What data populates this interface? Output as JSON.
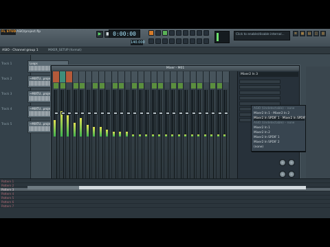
{
  "app": {
    "logo_text": "FL STUDIO",
    "menu_text": "ASIO/project.flp",
    "clock": "0:00:00",
    "tempo": "140.000",
    "hint": "Click to enable/disable internal...",
    "header_title": "ASIO - Channel group 1",
    "header_sub": "MIXER_SETUP (format)"
  },
  "browser": {
    "tracks": [
      "Track 1",
      "Track 2",
      "Track 3",
      "Track 4",
      "Track 5"
    ]
  },
  "clips": [
    {
      "name": "Loops"
    },
    {
      "name": "~MIXTU...project_5"
    },
    {
      "name": "~MIXTU...project_3"
    },
    {
      "name": "~MIXTU...project_4"
    },
    {
      "name": "~MIXTU...project_1"
    }
  ],
  "mixer": {
    "title": "Mixer - M01",
    "strips": [
      {
        "meter": 0.35,
        "fader": 0.75,
        "label": "hi"
      },
      {
        "meter": 0.55,
        "fader": 0.75,
        "label": "hi2"
      },
      {
        "meter": 0.45,
        "fader": 0.75,
        "label": "hi"
      },
      {
        "meter": 0.3,
        "fader": 0.75,
        "label": ""
      },
      {
        "meter": 0.4,
        "fader": 0.75,
        "label": ""
      },
      {
        "meter": 0.25,
        "fader": 0.75,
        "label": ""
      },
      {
        "meter": 0.2,
        "fader": 0.75,
        "label": ""
      },
      {
        "meter": 0.2,
        "fader": 0.75,
        "label": ""
      },
      {
        "meter": 0.15,
        "fader": 0.75,
        "label": ""
      },
      {
        "meter": 0.1,
        "fader": 0.75,
        "label": ""
      },
      {
        "meter": 0.1,
        "fader": 0.75,
        "label": ""
      },
      {
        "meter": 0.1,
        "fader": 0.75,
        "label": ""
      },
      {
        "meter": 0.05,
        "fader": 0.75,
        "label": ""
      },
      {
        "meter": 0.05,
        "fader": 0.75,
        "label": ""
      },
      {
        "meter": 0.05,
        "fader": 0.75,
        "label": ""
      },
      {
        "meter": 0.05,
        "fader": 0.75,
        "label": ""
      },
      {
        "meter": 0.05,
        "fader": 0.75,
        "label": ""
      },
      {
        "meter": 0.05,
        "fader": 0.75,
        "label": ""
      },
      {
        "meter": 0.05,
        "fader": 0.75,
        "label": ""
      },
      {
        "meter": 0.05,
        "fader": 0.75,
        "label": ""
      },
      {
        "meter": 0.05,
        "fader": 0.75,
        "label": ""
      },
      {
        "meter": 0.05,
        "fader": 0.75,
        "label": ""
      },
      {
        "meter": 0.05,
        "fader": 0.75,
        "label": ""
      },
      {
        "meter": 0.05,
        "fader": 0.75,
        "label": ""
      },
      {
        "meter": 0.05,
        "fader": 0.75,
        "label": ""
      },
      {
        "meter": 0.05,
        "fader": 0.75,
        "label": ""
      },
      {
        "meter": 0.05,
        "fader": 0.75,
        "label": ""
      }
    ],
    "insert_head": "Mixer2 In 3",
    "output": "Mixer2 Out 1 - Mixer2 Out 2"
  },
  "dropdown": {
    "items": [
      {
        "text": "ASIO (Undetectable) – none",
        "state": "dim"
      },
      {
        "text": "Mixer2 In 1 - Mixer2 In 2",
        "state": ""
      },
      {
        "text": "Mixer2 In SPDIF 1 - Mixer2 In SPDIF 2",
        "state": "active"
      },
      {
        "text": "ASIO (Undetectable) – none",
        "state": "dim"
      },
      {
        "text": "Mixer2 In 1",
        "state": ""
      },
      {
        "text": "Mixer2 In 2",
        "state": ""
      },
      {
        "text": "Mixer2 In SPDIF 1",
        "state": ""
      },
      {
        "text": "Mixer2 In SPDIF 2",
        "state": ""
      },
      {
        "text": "(none)",
        "state": ""
      }
    ]
  },
  "roll": {
    "rows": [
      "Pattern 1",
      "Pattern 2",
      "Pattern 3",
      "Pattern 4",
      "Pattern 5",
      "Pattern 6",
      "Pattern 7"
    ],
    "selected_index": 2
  }
}
